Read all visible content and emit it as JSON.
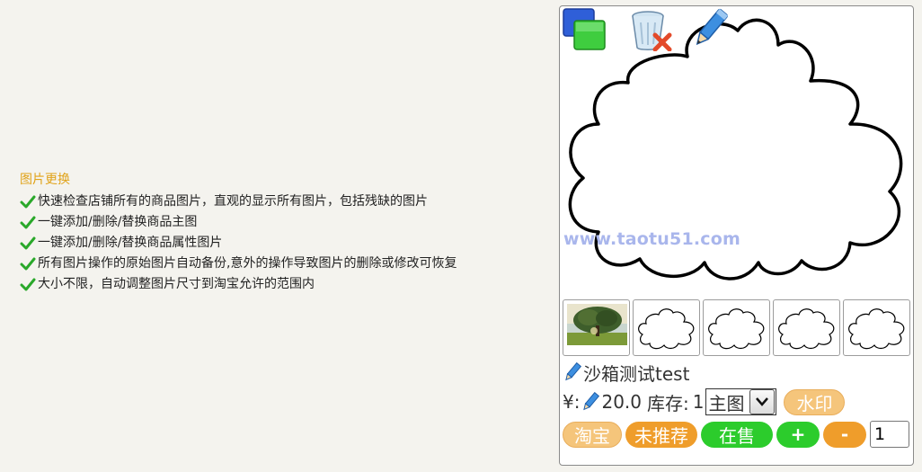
{
  "features": {
    "title": "图片更换",
    "items": [
      "快速检查店铺所有的商品图片，直观的显示所有图片，包括残缺的图片",
      "一键添加/删除/替换商品主图",
      "一键添加/删除/替换商品属性图片",
      "所有图片操作的原始图片自动备份,意外的操作导致图片的删除或修改可恢复",
      "大小不限，自动调整图片尺寸到淘宝允许的范围内"
    ]
  },
  "product": {
    "watermark_text": "www.taotu51.com",
    "thumbnails": [
      "tree-photo",
      "cloud",
      "cloud",
      "cloud",
      "cloud"
    ],
    "name": "沙箱测试test",
    "price_label": "¥:",
    "price": "20.0",
    "stock_label": "库存:",
    "stock": "1",
    "image_type": "主图",
    "watermark_button": "水印",
    "taobao_button": "淘宝",
    "recommend_button": "未推荐",
    "status_button": "在售",
    "plus_button": "+",
    "minus_button": "-",
    "quantity": "1"
  },
  "colors": {
    "title": "#e0a31a",
    "check": "#2aa82a",
    "pill_light": "#f5c57b",
    "pill_orange": "#ef9d2b",
    "pill_green": "#2ccc2c",
    "watermark": "#a9b6ec"
  }
}
